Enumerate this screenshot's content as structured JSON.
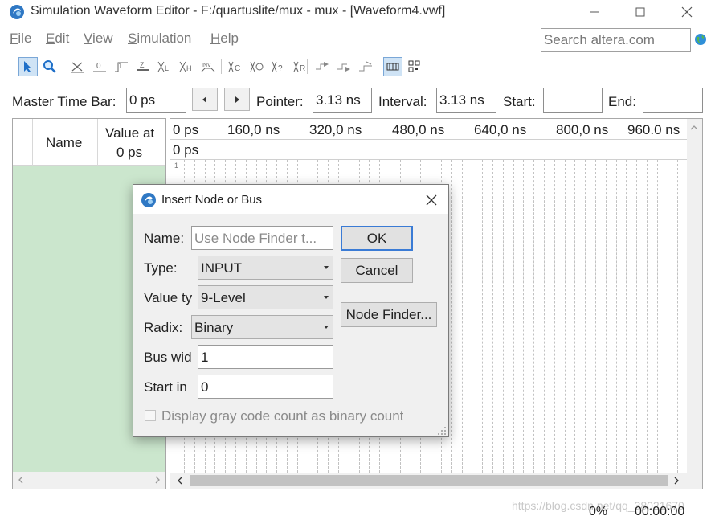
{
  "window": {
    "title": "Simulation Waveform Editor - F:/quartuslite/mux - mux - [Waveform4.vwf]",
    "icons": {
      "app": "quartus-logo-icon",
      "minimize": "minimize-icon",
      "maximize": "maximize-icon",
      "close": "close-icon"
    }
  },
  "menu": {
    "items": [
      {
        "label": "File"
      },
      {
        "label": "Edit"
      },
      {
        "label": "View"
      },
      {
        "label": "Simulation"
      },
      {
        "label": "Help"
      }
    ]
  },
  "search": {
    "placeholder": "Search altera.com",
    "icon": "globe-icon"
  },
  "toolbar": {
    "tools": [
      "selection-tool-icon",
      "zoom-tool-icon",
      "forcing-unknown-icon",
      "forcing-low-icon",
      "forcing-high-icon",
      "high-impedance-icon",
      "weak-unknown-icon",
      "weak-low-icon",
      "invert-icon",
      "count-value-icon",
      "overwrite-clock-icon",
      "random-values-icon",
      "arbitrary-value-icon",
      "simulate-icon",
      "functional-simulation-icon",
      "timing-simulation-icon",
      "snap-to-grid-icon",
      "grid-icon"
    ]
  },
  "timebar": {
    "master_label": "Master Time Bar:",
    "master_value": "0 ps",
    "pointer_label": "Pointer:",
    "pointer_value": "3.13 ns",
    "interval_label": "Interval:",
    "interval_value": "3.13 ns",
    "start_label": "Start:",
    "start_value": "",
    "end_label": "End:",
    "end_value": ""
  },
  "node_panel": {
    "name_header": "Name",
    "value_header_line1": "Value at",
    "value_header_line2": "0 ps",
    "colors": {
      "body": "#cbe6cd"
    }
  },
  "wave_panel": {
    "ticks": [
      "0 ps",
      "160,0 ns",
      "320,0 ns",
      "480,0 ns",
      "640,0 ns",
      "800,0 ns",
      "960.0 ns"
    ],
    "cursor_label": "0 ps",
    "cursor_marker": "1"
  },
  "status": {
    "progress": "0%",
    "elapsed": "00:00:00",
    "watermark": "https://blog.csdn.net/qq_38021670"
  },
  "dialog": {
    "title": "Insert Node or Bus",
    "name_label": "Name:",
    "name_placeholder": "Use Node Finder t...",
    "type_label": "Type:",
    "type_value": "INPUT",
    "value_type_label": "Value ty",
    "value_type_value": "9-Level",
    "radix_label": "Radix:",
    "radix_value": "Binary",
    "bus_width_label": "Bus wid",
    "bus_width_value": "1",
    "start_index_label": "Start in",
    "start_index_value": "0",
    "gray_code_label": "Display gray code count as binary count",
    "gray_code_checked": false,
    "ok": "OK",
    "cancel": "Cancel",
    "node_finder": "Node Finder..."
  }
}
